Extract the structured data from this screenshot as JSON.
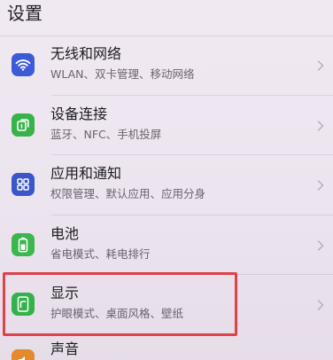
{
  "header": {
    "title": "设置"
  },
  "settings": {
    "items": [
      {
        "label": "无线和网络",
        "sublabel": "WLAN、双卡管理、移动网络",
        "icon": "wifi-icon",
        "icon_color": "#3d5bd9"
      },
      {
        "label": "设备连接",
        "sublabel": "蓝牙、NFC、手机投屏",
        "icon": "device-connection-icon",
        "icon_color": "#37b34a"
      },
      {
        "label": "应用和通知",
        "sublabel": "权限管理、默认应用、应用分身",
        "icon": "apps-grid-icon",
        "icon_color": "#3b56c8"
      },
      {
        "label": "电池",
        "sublabel": "省电模式、耗电排行",
        "icon": "battery-icon",
        "icon_color": "#3cb64e"
      },
      {
        "label": "显示",
        "sublabel": "护眼模式、桌面风格、壁纸",
        "icon": "display-icon",
        "icon_color": "#33b24c",
        "highlighted": true
      },
      {
        "label": "声音",
        "icon": "sound-icon",
        "icon_color": "#e28a2d"
      }
    ]
  },
  "highlight": {
    "color": "#e0424a",
    "target": "显示"
  }
}
